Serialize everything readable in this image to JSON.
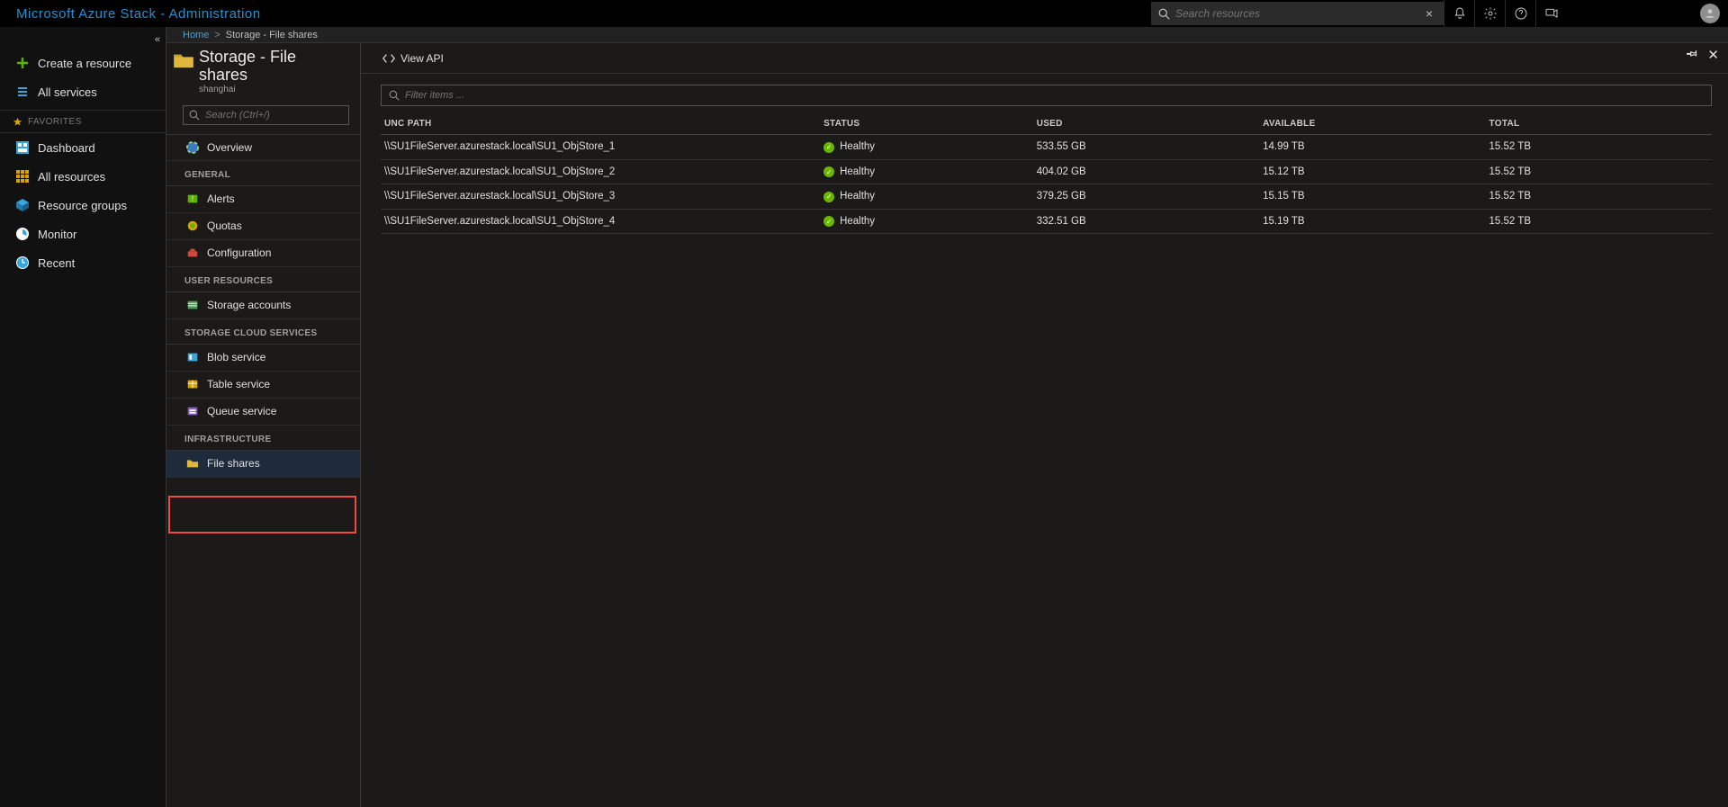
{
  "top": {
    "title": "Microsoft Azure Stack - Administration",
    "search_placeholder": "Search resources",
    "clear_symbol": "×",
    "pin_symbol": "📌",
    "close_symbol": "✕"
  },
  "globalNav": {
    "collapse_symbol": "«",
    "create_label": "Create a resource",
    "all_services_label": "All services",
    "favorites_label": "FAVORITES",
    "items": [
      {
        "label": "Dashboard"
      },
      {
        "label": "All resources"
      },
      {
        "label": "Resource groups"
      },
      {
        "label": "Monitor"
      },
      {
        "label": "Recent"
      }
    ]
  },
  "breadcrumb": {
    "home": "Home",
    "sep": ">",
    "current": "Storage - File shares"
  },
  "resourceMenu": {
    "title": "Storage - File shares",
    "subtitle": "shanghai",
    "search_placeholder": "Search (Ctrl+/)",
    "overview_label": "Overview",
    "sections": {
      "general": "GENERAL",
      "user": "USER RESOURCES",
      "cloud": "STORAGE CLOUD SERVICES",
      "infra": "INFRASTRUCTURE"
    },
    "general_items": [
      "Alerts",
      "Quotas",
      "Configuration"
    ],
    "user_items": [
      "Storage accounts"
    ],
    "cloud_items": [
      "Blob service",
      "Table service",
      "Queue service"
    ],
    "infra_items": [
      "File shares"
    ]
  },
  "blade": {
    "viewapi_label": "View API",
    "filter_placeholder": "Filter items ...",
    "columns": [
      "UNC PATH",
      "STATUS",
      "USED",
      "AVAILABLE",
      "TOTAL"
    ],
    "rows": [
      {
        "path": "\\\\SU1FileServer.azurestack.local\\SU1_ObjStore_1",
        "status": "Healthy",
        "used": "533.55 GB",
        "available": "14.99 TB",
        "total": "15.52 TB"
      },
      {
        "path": "\\\\SU1FileServer.azurestack.local\\SU1_ObjStore_2",
        "status": "Healthy",
        "used": "404.02 GB",
        "available": "15.12 TB",
        "total": "15.52 TB"
      },
      {
        "path": "\\\\SU1FileServer.azurestack.local\\SU1_ObjStore_3",
        "status": "Healthy",
        "used": "379.25 GB",
        "available": "15.15 TB",
        "total": "15.52 TB"
      },
      {
        "path": "\\\\SU1FileServer.azurestack.local\\SU1_ObjStore_4",
        "status": "Healthy",
        "used": "332.51 GB",
        "available": "15.19 TB",
        "total": "15.52 TB"
      }
    ]
  },
  "colors": {
    "accent": "#288ecb",
    "health_ok": "#6bb700",
    "highlight_box": "#f04a46"
  }
}
